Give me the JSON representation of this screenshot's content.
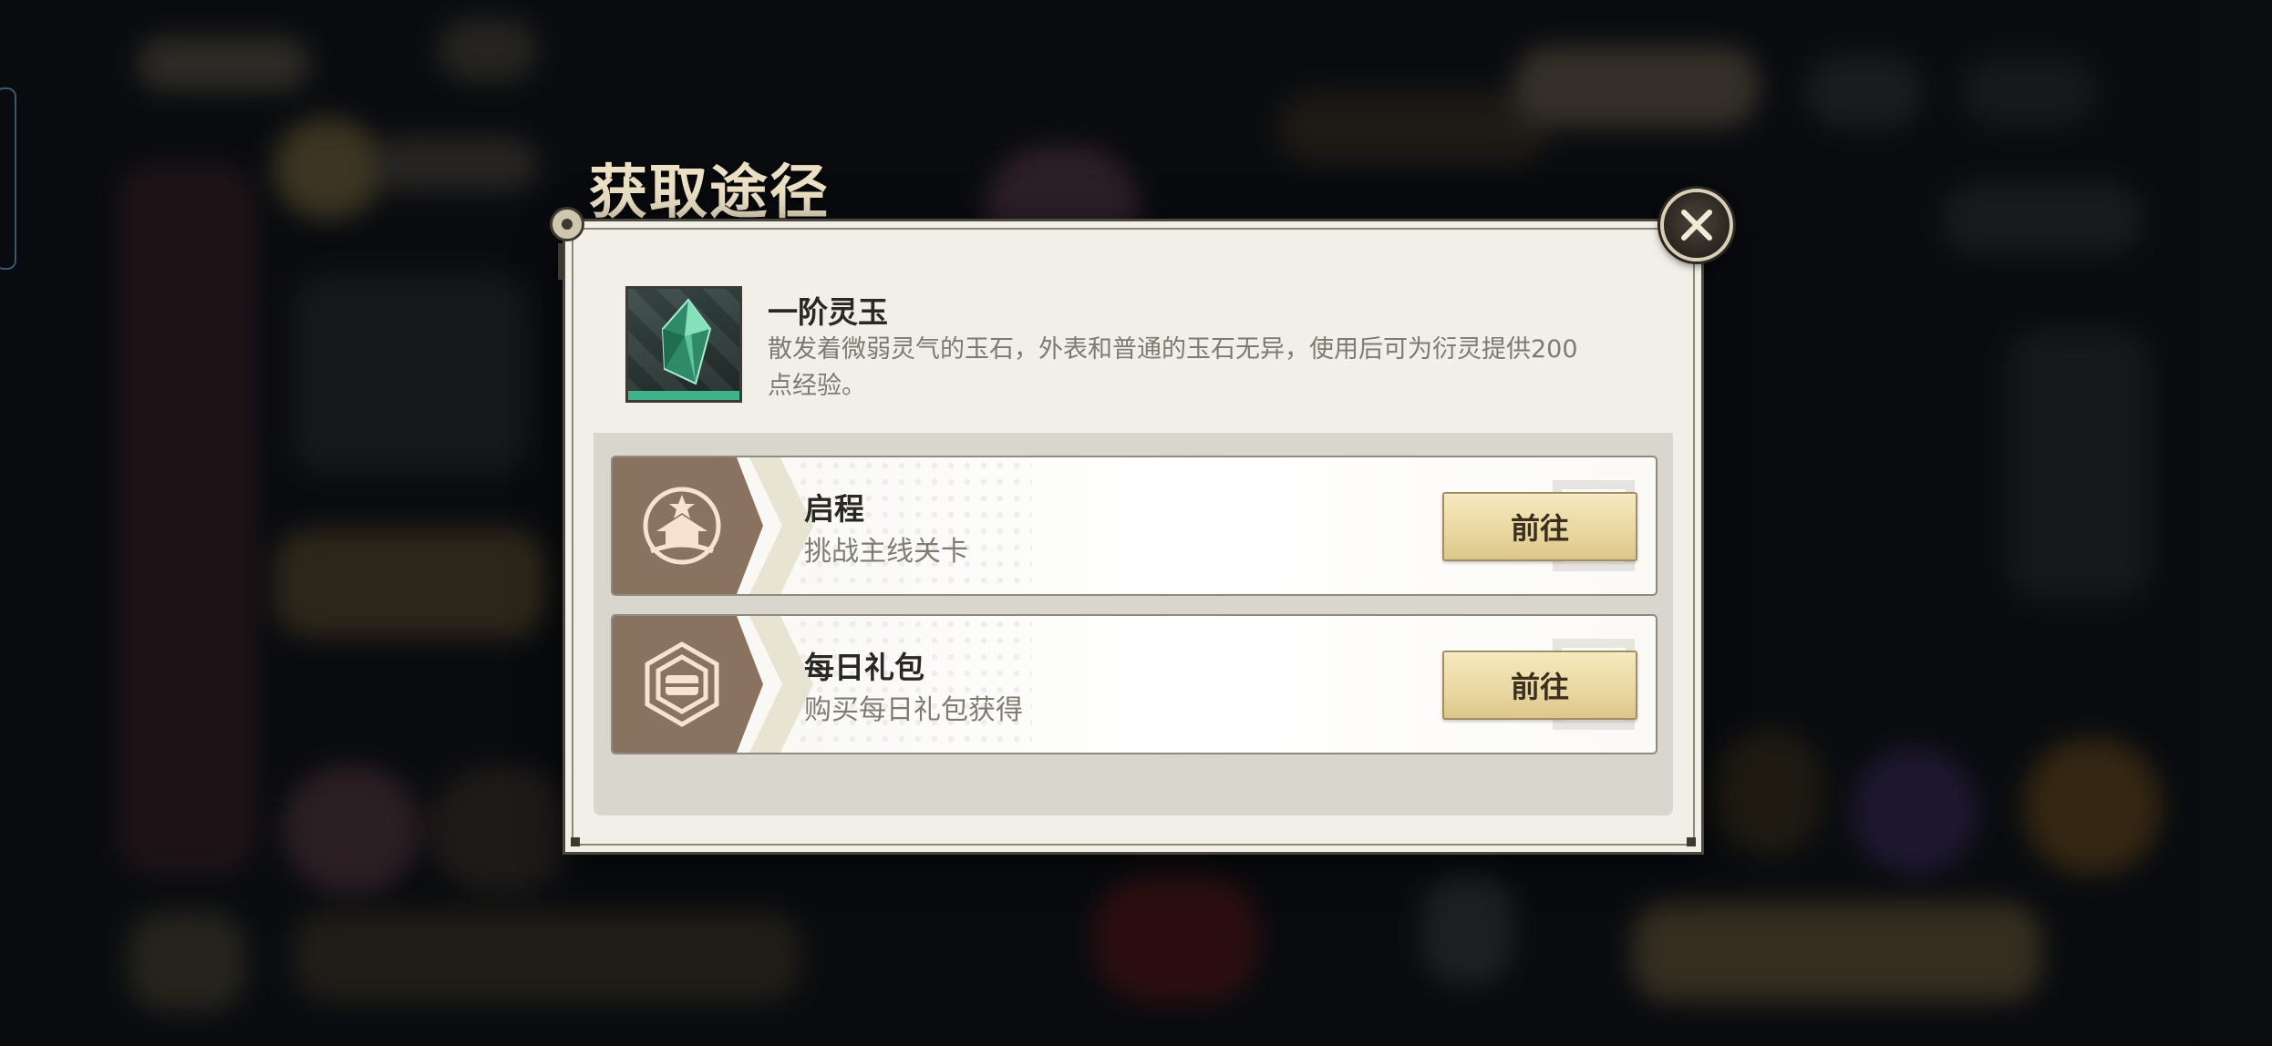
{
  "dialog": {
    "title": "获取途径"
  },
  "item": {
    "name": "一阶灵玉",
    "description": "散发着微弱灵气的玉石，外表和普通的玉石无异，使用后可为衍灵提供200点经验。",
    "icon": "green-jade-gem-icon"
  },
  "sources": [
    {
      "title": "启程",
      "description": "挑战主线关卡",
      "icon": "journey-pavilion-icon",
      "button_label": "前往"
    },
    {
      "title": "每日礼包",
      "description": "购买每日礼包获得",
      "icon": "gift-scroll-icon",
      "button_label": "前往"
    }
  ],
  "colors": {
    "dialog_background": "#f1efe7",
    "badge_brown": "#8a7261",
    "button_gold": "#e9d7a0",
    "close_button": "#2a2620"
  }
}
